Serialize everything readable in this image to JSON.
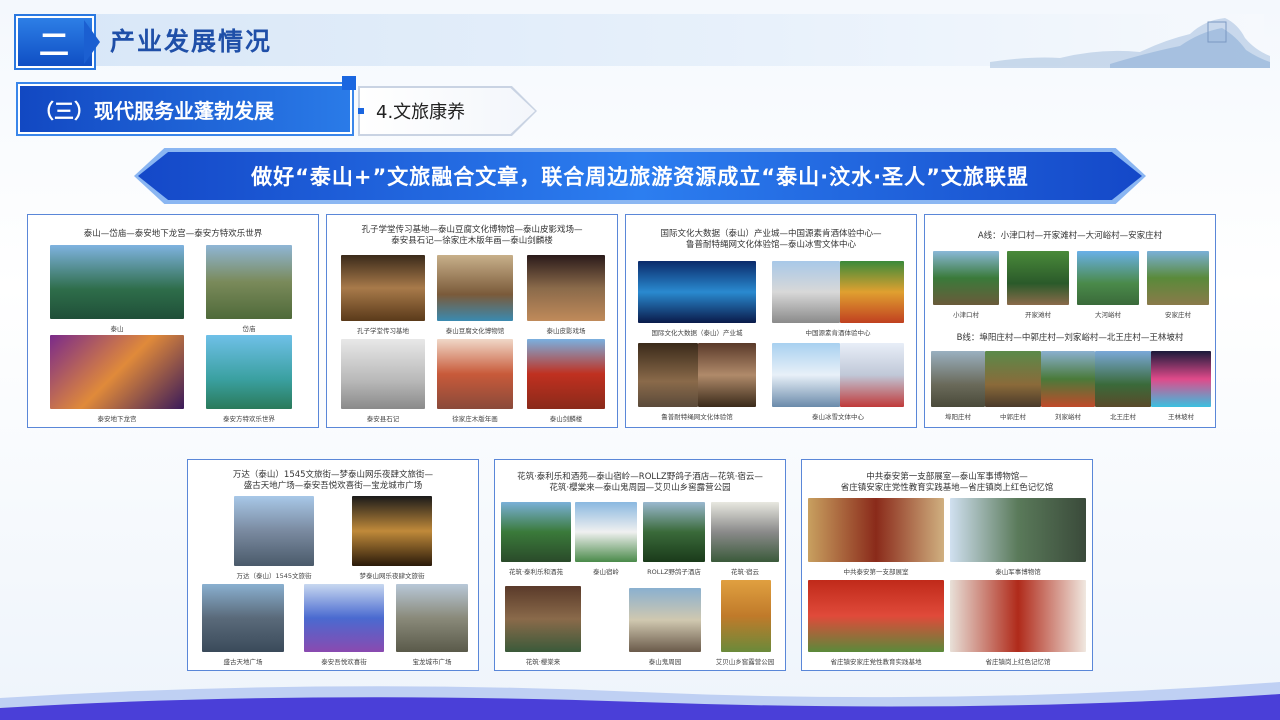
{
  "header": {
    "section_num": "二",
    "title": "产业发展情况"
  },
  "sub_header": {
    "label": "（三）现代服务业蓬勃发展",
    "tab": "4.文旅康养"
  },
  "banner": {
    "text": "做好“泰山+”文旅融合文章，联合周边旅游资源成立“泰山·汶水·圣人”文旅联盟"
  },
  "panels": [
    {
      "title": "泰山—岱庙—泰安地下龙宫—泰安方特欢乐世界",
      "captions": [
        "泰山",
        "岱庙",
        "泰安地下龙宫",
        "泰安方特欢乐世界"
      ]
    },
    {
      "title_lines": [
        "孔子学堂传习基地—泰山豆腐文化博物馆—泰山皮影戏场—",
        "泰安县石记—徐家庄木版年画—泰山剑麟楼"
      ],
      "captions": [
        "孔子学堂传习基地",
        "泰山豆腐文化博物馆",
        "泰山皮影戏场",
        "泰安县石记",
        "徐家庄木版年画",
        "泰山剑麟楼"
      ]
    },
    {
      "title_lines": [
        "国际文化大数据（泰山）产业城—中国源素肯酒体验中心—",
        "鲁普耐特绳网文化体验馆—泰山冰雪文体中心"
      ],
      "captions": [
        "国际文化大数据（泰山）产业城",
        "中国源素肯酒体验中心",
        "鲁普耐特绳网文化体验馆",
        "泰山冰雪文体中心"
      ]
    },
    {
      "line_a": "A线：小津口村—开家滩村—大河峪村—安家庄村",
      "captions_a": [
        "小津口村",
        "开家滩村",
        "大河峪村",
        "安家庄村"
      ],
      "line_b": "B线：埠阳庄村—中郭庄村—刘家峪村—北王庄村—王林坡村",
      "captions_b": [
        "埠阳庄村",
        "中郭庄村",
        "刘家峪村",
        "北王庄村",
        "王林坡村"
      ]
    },
    {
      "title_lines": [
        "万达（泰山）1545文旅街—梦泰山网乐夜肆文旅街—",
        "盛古天地广场—泰安吾悦欢喜街—宝龙城市广场"
      ],
      "captions": [
        "万达（泰山）1545文旅街",
        "梦泰山网乐夜肆文旅街",
        "盛古天地广场",
        "泰安吾悦欢喜街",
        "宝龙城市广场"
      ]
    },
    {
      "title_lines": [
        "花筑·泰利乐和酒苑—泰山宿岭—ROLLZ野鸽子酒店—花筑·宿云—",
        "花筑·櫻棠来—泰山鬼周园—艾贝山乡窖露营公园"
      ],
      "captions": [
        "花筑·泰利乐和酒苑",
        "泰山宿岭",
        "ROLLZ野鸽子酒店",
        "花筑·宿云",
        "花筑·櫻棠来",
        "泰山鬼周园",
        "艾贝山乡窖露营公园"
      ]
    },
    {
      "title_lines": [
        "中共泰安第一支部展室—泰山军事博物馆—",
        "省庄镇安家庄党性教育实践基地—省庄镇岗上红色记忆馆"
      ],
      "captions": [
        "中共泰安第一支部展室",
        "泰山军事博物馆",
        "省庄镇安家庄党性教育实践基地",
        "省庄镇岗上红色记忆馆"
      ]
    }
  ]
}
